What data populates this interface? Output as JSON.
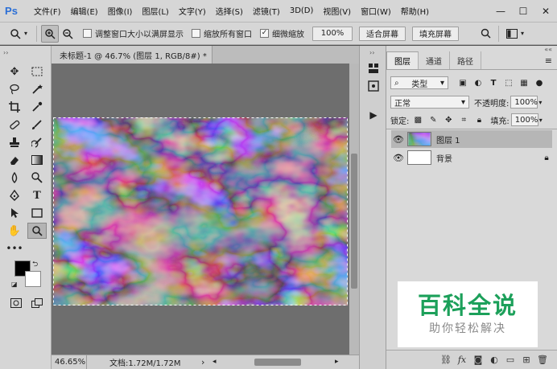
{
  "app": {
    "logo": "Ps"
  },
  "menu": [
    "文件(F)",
    "编辑(E)",
    "图像(I)",
    "图层(L)",
    "文字(Y)",
    "选择(S)",
    "滤镜(T)",
    "3D(D)",
    "视图(V)",
    "窗口(W)",
    "帮助(H)"
  ],
  "window_controls": {
    "minimize": "—",
    "maximize": "☐",
    "close": "✕"
  },
  "options": {
    "resize_windows": "调整窗口大小以满屏显示",
    "zoom_all": "缩放所有窗口",
    "scrubby_zoom": "细微缩放",
    "zoom_100": "100%",
    "fit_screen": "适合屏幕",
    "fill_screen": "填充屏幕"
  },
  "document": {
    "tab_title": "未标题-1 @ 46.7% (图层 1, RGB/8#) *",
    "close": "×",
    "zoom": "46.65%",
    "doc_info": "文档:1.72M/1.72M",
    "arrow": "›"
  },
  "layers_panel": {
    "tabs": [
      "图层",
      "通道",
      "路径"
    ],
    "filter_kind": "类型",
    "blend_mode": "正常",
    "opacity_label": "不透明度:",
    "opacity_value": "100%",
    "lock_label": "锁定:",
    "fill_label": "填充:",
    "fill_value": "100%",
    "layers": [
      {
        "name": "图层 1",
        "selected": true
      },
      {
        "name": "背景",
        "selected": false
      }
    ]
  },
  "watermark": {
    "title": "百科全说",
    "subtitle": "助你轻松解决"
  },
  "colors": {
    "foreground": "#000000",
    "background": "#ffffff",
    "panel_bg": "#d6d6d6",
    "workspace": "#6e6e6e",
    "watermark_green": "#1ca05a"
  }
}
